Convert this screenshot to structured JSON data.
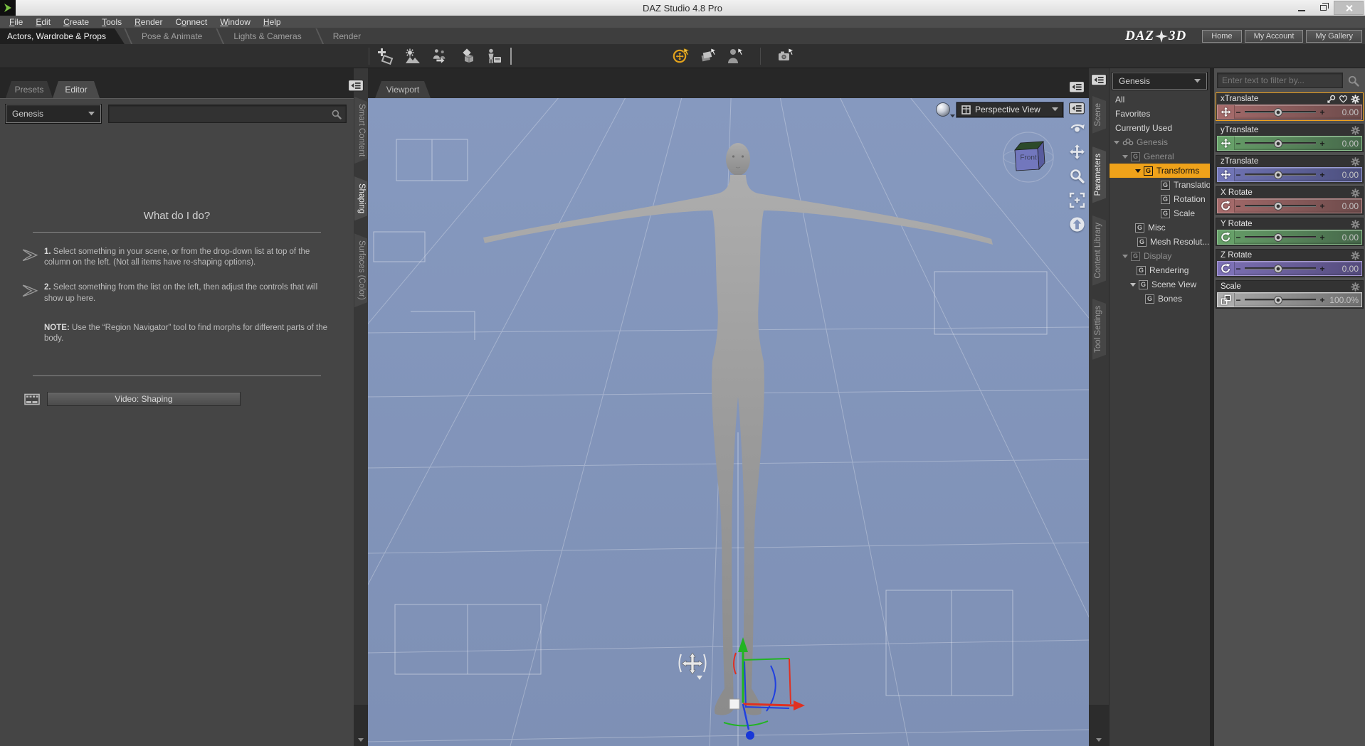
{
  "window": {
    "title": "DAZ Studio 4.8 Pro"
  },
  "menu": {
    "items": [
      {
        "pre": "",
        "accel": "F",
        "post": "ile"
      },
      {
        "pre": "",
        "accel": "E",
        "post": "dit"
      },
      {
        "pre": "",
        "accel": "C",
        "post": "reate"
      },
      {
        "pre": "",
        "accel": "T",
        "post": "ools"
      },
      {
        "pre": "",
        "accel": "R",
        "post": "ender"
      },
      {
        "pre": "C",
        "accel": "o",
        "post": "nnect"
      },
      {
        "pre": "",
        "accel": "W",
        "post": "indow"
      },
      {
        "pre": "",
        "accel": "H",
        "post": "elp"
      }
    ]
  },
  "activity_tabs": {
    "items": [
      "Actors, Wardrobe & Props",
      "Pose & Animate",
      "Lights & Cameras",
      "Render"
    ],
    "active_index": 0
  },
  "brand": {
    "logo_daz": "DAZ",
    "logo_3d": "3D",
    "buttons": [
      "Home",
      "My Account",
      "My Gallery"
    ]
  },
  "toolbar": {
    "content_tools": [
      "new-content-icon",
      "render-icon",
      "fit-figure-icon",
      "surfaces-icon",
      "save-figure-icon"
    ],
    "scene_tools": [
      "universal-tool-icon",
      "surface-selection-tool-icon",
      "node-selection-tool-icon",
      "camera-tool-icon"
    ],
    "active_scene_tool": "universal-tool-icon"
  },
  "left_panel": {
    "tabs": [
      "Presets",
      "Editor"
    ],
    "active_tab": "Editor",
    "figure_selector": {
      "value": "Genesis"
    },
    "search": {
      "placeholder": ""
    },
    "help": {
      "title": "What do I do?",
      "steps": [
        {
          "bold": "1.",
          "text": " Select something in your scene, or from the drop-down list at top of the column on the left. (Not all items have re-shaping options)."
        },
        {
          "bold": "2.",
          "text": " Select something from the list on the left, then adjust the controls that will show up here."
        }
      ],
      "note": {
        "bold": "NOTE:",
        "text": " Use the “Region Navigator” tool to find morphs for different parts of the body."
      },
      "video_button": "Video: Shaping"
    }
  },
  "left_dock_tabs": {
    "items": [
      "Smart Content",
      "Shaping",
      "Surfaces (Color)"
    ],
    "active": "Shaping"
  },
  "right_dock_tabs": {
    "items": [
      "Scene",
      "Parameters",
      "Content Library",
      "Tool Settings"
    ],
    "active": "Parameters"
  },
  "viewport": {
    "tab_label": "Viewport",
    "view_selector": "Perspective View",
    "cube_front_label": "Front",
    "bg_color": "#8294ba",
    "nav_tools": [
      "orbit-icon",
      "pan-icon",
      "zoom-icon",
      "frame-icon",
      "aim-icon"
    ]
  },
  "parameters_panel": {
    "group_selector": {
      "value": "Genesis"
    },
    "filter": {
      "placeholder": "Enter text to filter by..."
    },
    "selection_color": "#efa21a",
    "tree": [
      {
        "label": "All",
        "indent": 8,
        "icon": "none"
      },
      {
        "label": "Favorites",
        "indent": 8,
        "icon": "none"
      },
      {
        "label": "Currently Used",
        "indent": 8,
        "icon": "none"
      },
      {
        "label": "Genesis",
        "indent": 6,
        "icon": "figure",
        "expanded": true,
        "dim": true
      },
      {
        "label": "General",
        "indent": 18,
        "icon": "g",
        "expanded": true,
        "dim": true
      },
      {
        "label": "Transforms",
        "indent": 36,
        "icon": "g",
        "expanded": true,
        "selected": true
      },
      {
        "label": "Translation",
        "indent": 72,
        "icon": "g"
      },
      {
        "label": "Rotation",
        "indent": 72,
        "icon": "g"
      },
      {
        "label": "Scale",
        "indent": 72,
        "icon": "g"
      },
      {
        "label": "Misc",
        "indent": 36,
        "icon": "g"
      },
      {
        "label": "Mesh Resolut...",
        "indent": 39,
        "icon": "g"
      },
      {
        "label": "Display",
        "indent": 18,
        "icon": "g",
        "expanded": true,
        "dim": true
      },
      {
        "label": "Rendering",
        "indent": 38,
        "icon": "g"
      },
      {
        "label": "Scene View",
        "indent": 29,
        "icon": "g",
        "expanded": true
      },
      {
        "label": "Bones",
        "indent": 50,
        "icon": "g"
      }
    ],
    "sliders": [
      {
        "label": "xTranslate",
        "value": "0.00",
        "kind": "translate",
        "c1": "#a46a6a",
        "c2": "#6d4b4b",
        "border": "#bf8f8f",
        "selected": true,
        "header_icons": [
          "link-icon",
          "heart-icon",
          "gear-icon"
        ]
      },
      {
        "label": "yTranslate",
        "value": "0.00",
        "kind": "translate",
        "c1": "#67a069",
        "c2": "#46684a",
        "border": "#8cc28e",
        "header_icons": [
          "gear-icon"
        ]
      },
      {
        "label": "zTranslate",
        "value": "0.00",
        "kind": "translate",
        "c1": "#7175b6",
        "c2": "#4b4e7c",
        "border": "#989cd4",
        "header_icons": [
          "gear-icon"
        ]
      },
      {
        "label": "X Rotate",
        "value": "0.00",
        "kind": "rotate",
        "c1": "#a46a6a",
        "c2": "#6d4b4b",
        "border": "#bf8f8f",
        "header_icons": [
          "gear-icon"
        ]
      },
      {
        "label": "Y Rotate",
        "value": "0.00",
        "kind": "rotate",
        "c1": "#67a069",
        "c2": "#46684a",
        "border": "#8cc28e",
        "header_icons": [
          "gear-icon"
        ]
      },
      {
        "label": "Z Rotate",
        "value": "0.00",
        "kind": "rotate",
        "c1": "#7d71b6",
        "c2": "#544b7c",
        "border": "#a698d4",
        "header_icons": [
          "gear-icon"
        ]
      },
      {
        "label": "Scale",
        "value": "100.0%",
        "kind": "scale",
        "c1": "#adadad",
        "c2": "#6f6f6f",
        "border": "#d2d2d2",
        "header_icons": [
          "gear-icon"
        ]
      }
    ]
  }
}
